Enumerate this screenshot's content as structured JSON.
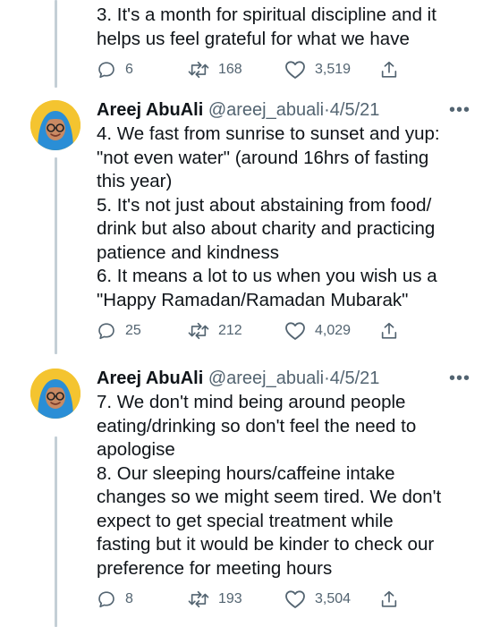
{
  "tweets": [
    {
      "text": "3. It's a month for spiritual discipline and it\nhelps us feel grateful for what we have",
      "replies": "6",
      "retweets": "168",
      "likes": "3,519"
    },
    {
      "author": "Areej AbuAli",
      "handle": "@areej_abuali",
      "dot": "·",
      "date": "4/5/21",
      "more": "•••",
      "text": "4. We fast from sunrise to sunset and yup:\n\"not even water\" (around 16hrs of fasting\nthis year)\n5. It's not just about abstaining from food/\ndrink but also about charity and practicing\npatience and kindness\n6. It means a lot to us when you wish us a\n\"Happy Ramadan/Ramadan Mubarak\"",
      "replies": "25",
      "retweets": "212",
      "likes": "4,029"
    },
    {
      "author": "Areej AbuAli",
      "handle": "@areej_abuali",
      "dot": "·",
      "date": "4/5/21",
      "more": "•••",
      "text": "7. We don't mind being around people\neating/drinking so don't feel the need to\napologise\n8. Our sleeping hours/caffeine intake\nchanges so we might seem tired. We don't\nexpect to get special treatment while\nfasting but it would be kinder to check our\npreference for meeting hours",
      "replies": "8",
      "retweets": "193",
      "likes": "3,504"
    }
  ],
  "icons": {
    "reply": "reply-icon",
    "retweet": "retweet-icon",
    "like": "like-icon",
    "share": "share-icon",
    "more": "more-icon"
  },
  "colors": {
    "secondary_text": "#536471",
    "thread_line": "#c4cfd6",
    "avatar_bg": "#f4c430",
    "hijab": "#2a8ed6"
  }
}
